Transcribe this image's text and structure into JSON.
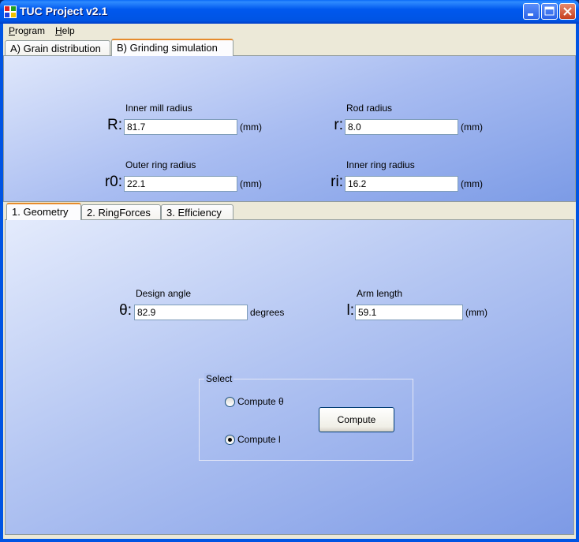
{
  "window": {
    "title": "TUC Project v2.1",
    "colors": {
      "titlebar": "#0054e3",
      "panel_gradient_start": "#dfe7fb",
      "panel_gradient_end": "#7c9be6",
      "selected_tab_accent": "#e68b2c"
    }
  },
  "menu": {
    "items": [
      {
        "label": "Program",
        "mnemonic": "P"
      },
      {
        "label": "Help",
        "mnemonic": "H"
      }
    ]
  },
  "main_tabs": {
    "tabs": [
      {
        "label": "A) Grain distribution",
        "selected": false
      },
      {
        "label": "B) Grinding simulation",
        "selected": true
      }
    ]
  },
  "mill_params": {
    "R": {
      "symbol": "R:",
      "label": "Inner mill radius",
      "value": "81.7",
      "unit": "(mm)"
    },
    "r": {
      "symbol": "r:",
      "label": "Rod radius",
      "value": "8.0",
      "unit": "(mm)"
    },
    "r0": {
      "symbol": "r0:",
      "label": "Outer ring radius",
      "value": "22.1",
      "unit": "(mm)"
    },
    "ri": {
      "symbol": "ri:",
      "label": "Inner ring radius",
      "value": "16.2",
      "unit": "(mm)"
    }
  },
  "sub_tabs": {
    "tabs": [
      {
        "label": "1. Geometry",
        "selected": true
      },
      {
        "label": "2. RingForces",
        "selected": false
      },
      {
        "label": "3. Efficiency",
        "selected": false
      }
    ]
  },
  "geometry": {
    "theta": {
      "symbol": "θ:",
      "label": "Design angle",
      "value": "82.9",
      "unit": "degrees"
    },
    "l": {
      "symbol": "l:",
      "label": "Arm length",
      "value": "59.1",
      "unit": "(mm)"
    },
    "select_group": {
      "title": "Select",
      "options": [
        {
          "label": "Compute θ",
          "checked": false
        },
        {
          "label": "Compute l",
          "checked": true
        }
      ]
    },
    "compute_button": "Compute"
  }
}
